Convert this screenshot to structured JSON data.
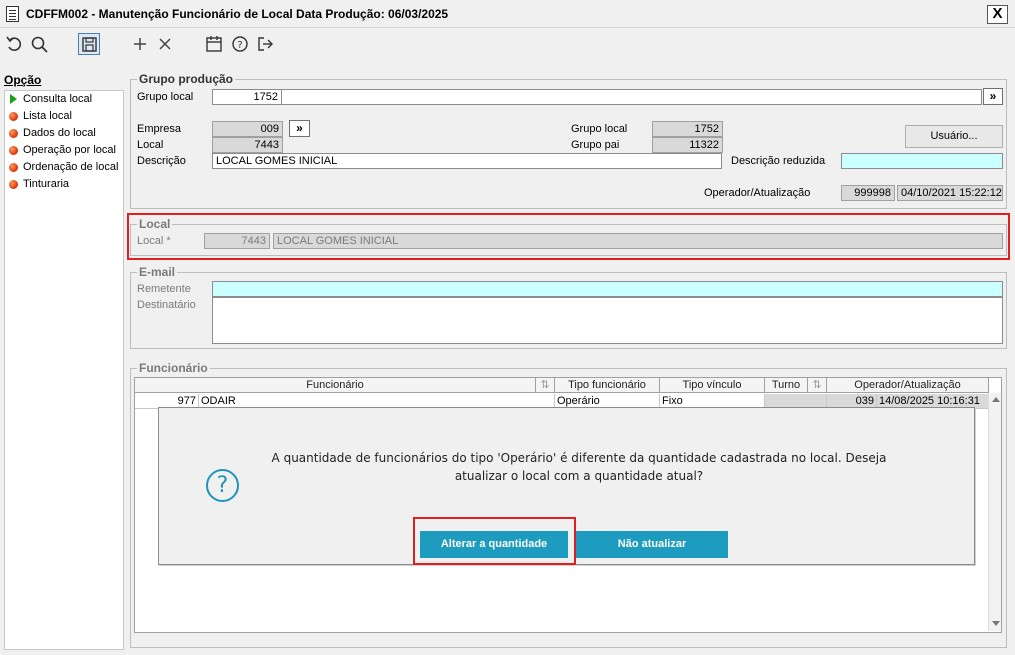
{
  "window": {
    "title": "CDFFM002 - Manutenção Funcionário de Local Data Produção: 06/03/2025",
    "close_label": "X"
  },
  "toolbar": {
    "icons": [
      "undo-icon",
      "search-icon",
      "save-icon",
      "add-icon",
      "close-icon",
      "calendar-icon",
      "help-icon",
      "exit-icon"
    ]
  },
  "sidebar": {
    "title": "Opção",
    "items": [
      {
        "label": "Consulta local",
        "active": true
      },
      {
        "label": "Lista local"
      },
      {
        "label": "Dados do local"
      },
      {
        "label": "Operação por local"
      },
      {
        "label": "Ordenação de local"
      },
      {
        "label": "Tinturaria"
      }
    ]
  },
  "grupo_producao": {
    "title": "Grupo produção",
    "grupo_local_label": "Grupo local",
    "grupo_local_value": "1752",
    "expand_label": "»",
    "empresa_label": "Empresa",
    "empresa_value": "009",
    "local_label": "Local",
    "local_value": "7443",
    "descricao_label": "Descrição",
    "descricao_value": "LOCAL GOMES INICIAL",
    "grupo_local2_label": "Grupo local",
    "grupo_local2_value": "1752",
    "grupo_pai_label": "Grupo pai",
    "grupo_pai_value": "11322",
    "usuario_button": "Usuário...",
    "descricao_reduzida_label": "Descrição reduzida",
    "descricao_reduzida_value": "",
    "operador_label": "Operador/Atualização",
    "operador_value": "999998",
    "atualizacao_value": "04/10/2021 15:22:12"
  },
  "local": {
    "title": "Local",
    "local_label": "Local *",
    "local_code": "7443",
    "local_desc": "LOCAL GOMES INICIAL"
  },
  "email": {
    "title": "E-mail",
    "remetente_label": "Remetente",
    "remetente_value": "",
    "destinatario_label": "Destinatário",
    "destinatario_value": ""
  },
  "funcionario": {
    "title": "Funcionário",
    "columns": [
      "Funcionário",
      "Tipo funcionário",
      "Tipo vínculo",
      "Turno",
      "Operador/Atualização"
    ],
    "rows": [
      {
        "code": "977",
        "name": "ODAIR",
        "tipo_funcionario": "Operário",
        "tipo_vinculo": "Fixo",
        "turno": "",
        "operador": "039",
        "atualizacao": "14/08/2025 10:16:31"
      }
    ]
  },
  "dialog": {
    "message_line1": "A quantidade de funcionários do tipo 'Operário' é diferente da quantidade cadastrada no local. Deseja",
    "message_line2": "atualizar o local com a quantidade atual?",
    "icon": "question-icon",
    "primary_button": "Alterar a quantidade",
    "secondary_button": "Não atualizar"
  },
  "colors": {
    "highlight_red": "#e02020",
    "dialog_button": "#1d9cbf",
    "required_field": "#ccffff"
  }
}
